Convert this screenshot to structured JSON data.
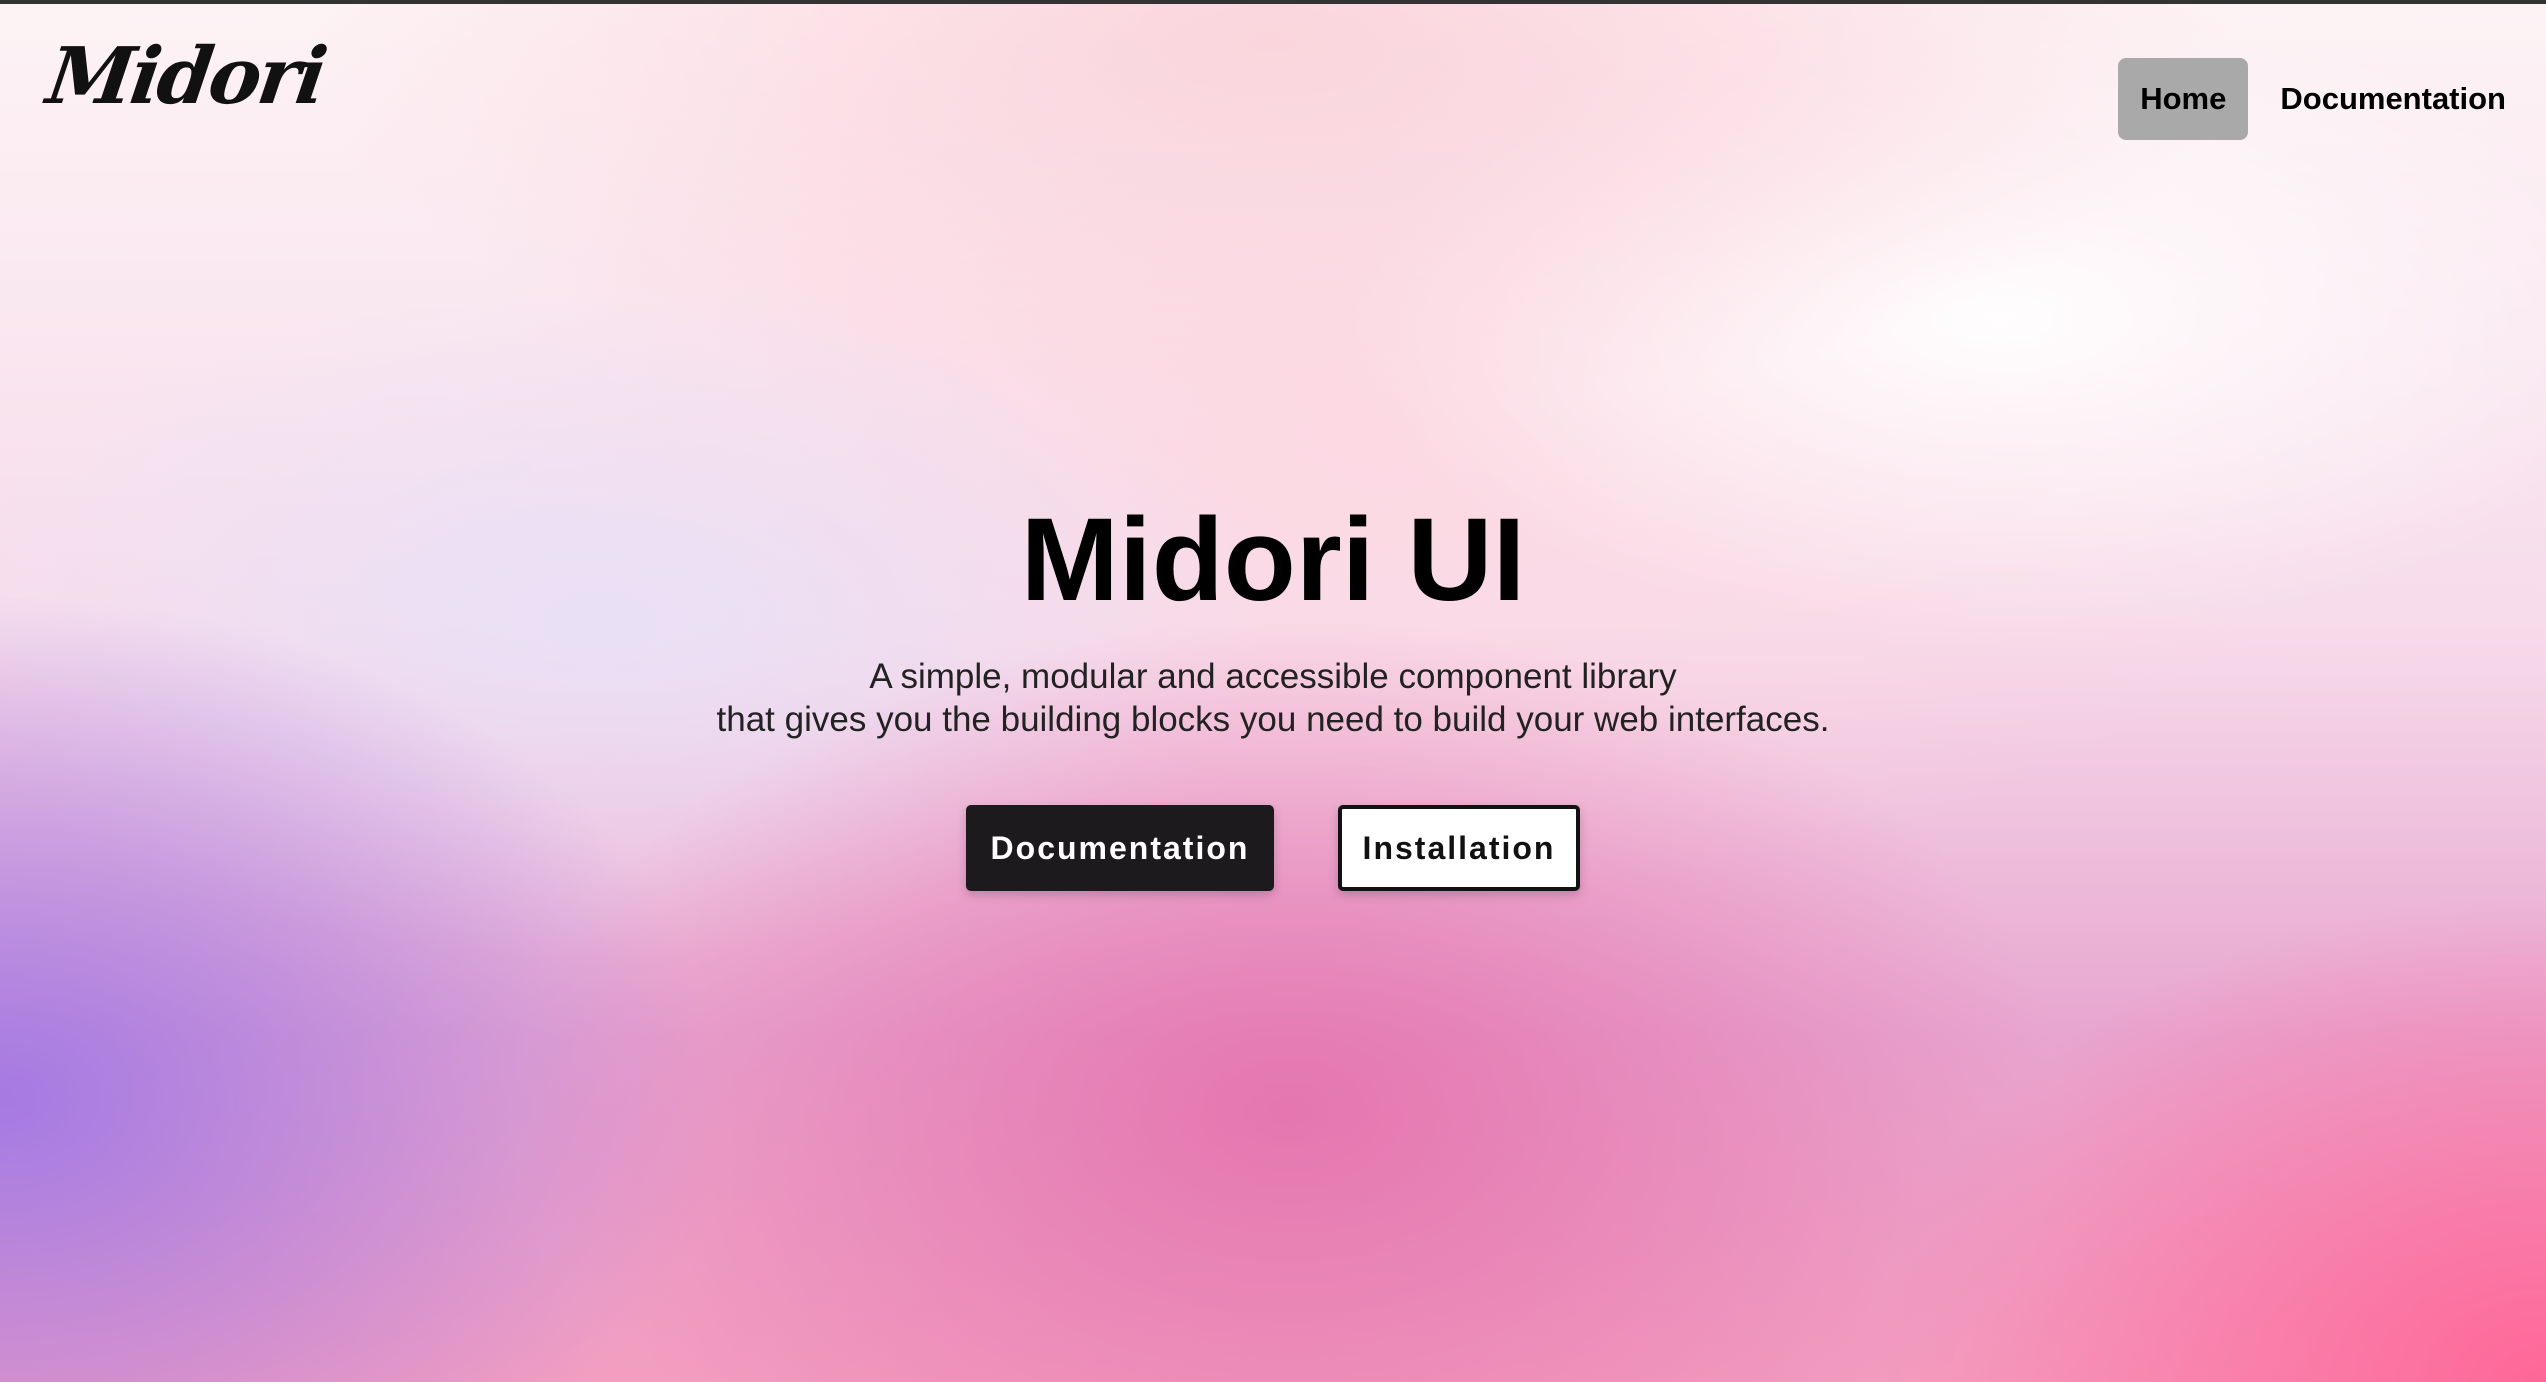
{
  "header": {
    "logo_text": "Midori",
    "nav": {
      "home_label": "Home",
      "documentation_label": "Documentation",
      "active_item": "Home"
    }
  },
  "hero": {
    "title": "Midori UI",
    "subtitle_line1": "A simple, modular and accessible component library",
    "subtitle_line2": "that gives you the building blocks you need to build your web interfaces.",
    "primary_button_label": "Documentation",
    "secondary_button_label": "Installation"
  },
  "colors": {
    "primary_button_bg": "#1c1a1c",
    "active_nav_bg": "#a9a9a9",
    "gradient_pink": "#ff6a96",
    "gradient_purple": "#a07ae4"
  }
}
